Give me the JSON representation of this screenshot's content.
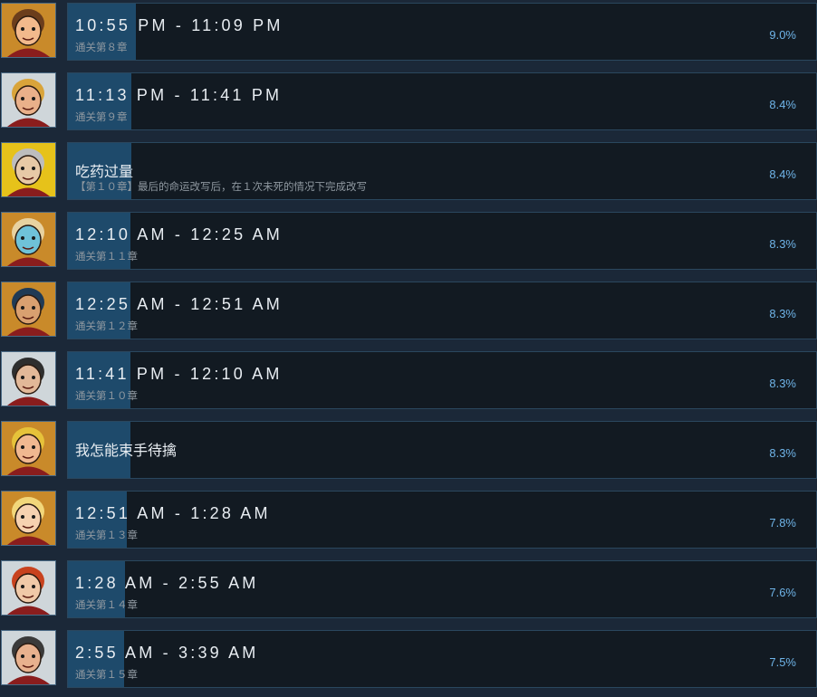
{
  "achievements": [
    {
      "title": "10:55 PM - 11:09 PM",
      "desc": "通关第８章",
      "percent": "9.0%",
      "progress_pct": 9.0,
      "icon": "bald-man-portrait-icon",
      "icon_bg": "#c98a2a"
    },
    {
      "title": "11:13 PM - 11:41 PM",
      "desc": "通关第９章",
      "percent": "8.4%",
      "progress_pct": 8.4,
      "icon": "bearded-man-portrait-icon",
      "icon_bg": "#cfd6da"
    },
    {
      "title": "吃药过量",
      "desc": "【第１０章】最后的命运改写后，在１次未死的情况下完成改写",
      "percent": "8.4%",
      "progress_pct": 8.4,
      "icon": "old-scientist-portrait-icon",
      "icon_bg": "#e6c21a"
    },
    {
      "title": "12:10 AM - 12:25 AM",
      "desc": "通关第１１章",
      "percent": "8.3%",
      "progress_pct": 8.3,
      "icon": "blue-woman-portrait-icon",
      "icon_bg": "#c98a2a"
    },
    {
      "title": "12:25 AM - 12:51 AM",
      "desc": "通关第１２章",
      "percent": "8.3%",
      "progress_pct": 8.3,
      "icon": "hooded-guard-portrait-icon",
      "icon_bg": "#c98a2a"
    },
    {
      "title": "11:41 PM - 12:10 AM",
      "desc": "通关第１０章",
      "percent": "8.3%",
      "progress_pct": 8.3,
      "icon": "mustached-officer-portrait-icon",
      "icon_bg": "#cfd6da"
    },
    {
      "title": "我怎能束手待擒",
      "desc": "",
      "percent": "8.3%",
      "progress_pct": 8.3,
      "icon": "sunglasses-man-portrait-icon",
      "icon_bg": "#c98a2a"
    },
    {
      "title": "12:51 AM - 1:28 AM",
      "desc": "通关第１３章",
      "percent": "7.8%",
      "progress_pct": 7.8,
      "icon": "blonde-girl-portrait-icon",
      "icon_bg": "#c98a2a"
    },
    {
      "title": "1:28 AM - 2:55 AM",
      "desc": "通关第１４章",
      "percent": "7.6%",
      "progress_pct": 7.6,
      "icon": "red-hair-woman-portrait-icon",
      "icon_bg": "#cfd6da"
    },
    {
      "title": "2:55 AM - 3:39 AM",
      "desc": "通关第１５章",
      "percent": "7.5%",
      "progress_pct": 7.5,
      "icon": "spiky-hair-man-portrait-icon",
      "icon_bg": "#cfd6da"
    }
  ]
}
